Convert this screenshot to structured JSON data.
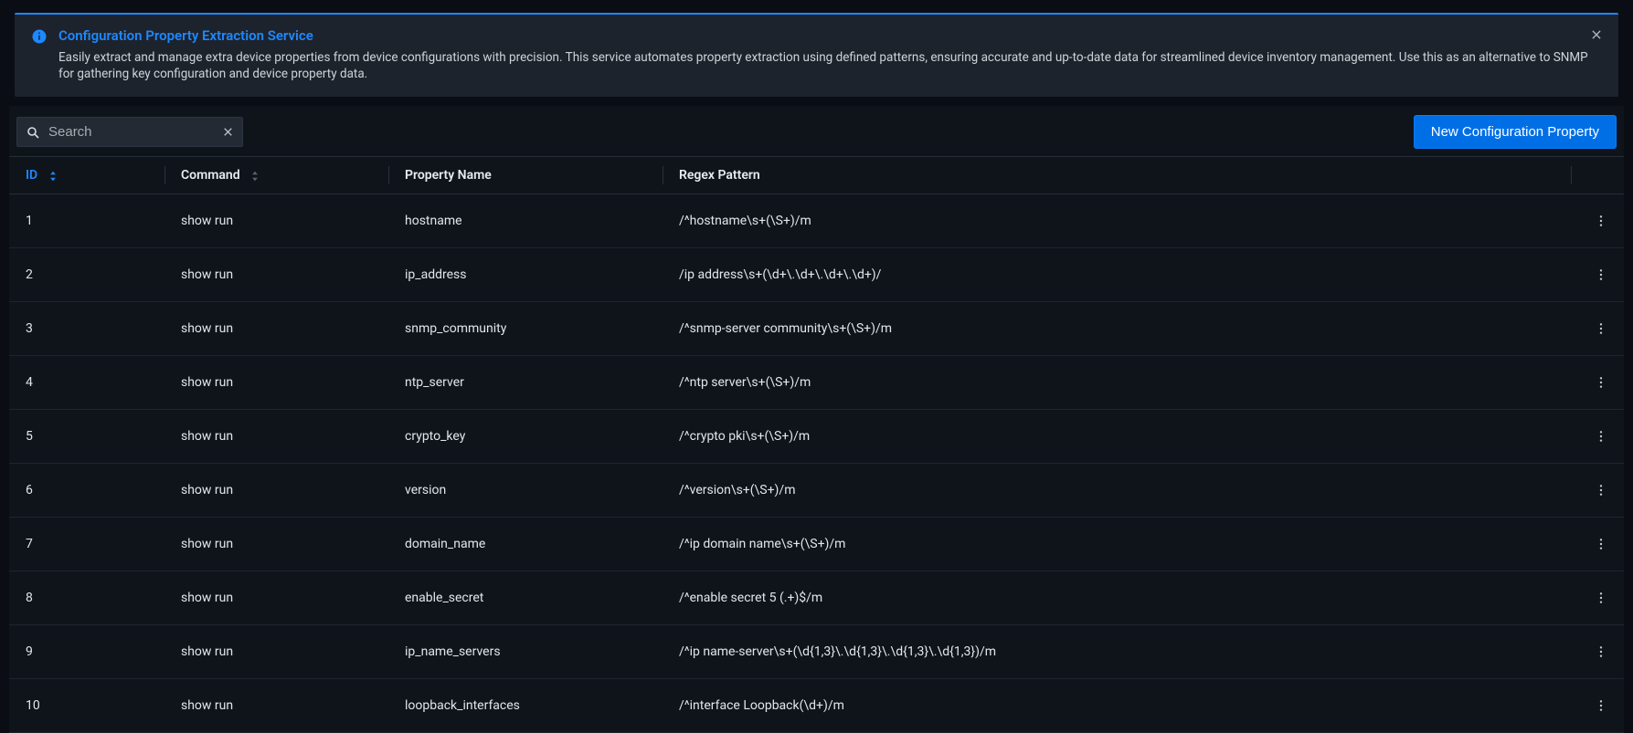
{
  "banner": {
    "title": "Configuration Property Extraction Service",
    "description": "Easily extract and manage extra device properties from device configurations with precision. This service automates property extraction using defined patterns, ensuring accurate and up-to-date data for streamlined device inventory management. Use this as an alternative to SNMP for gathering key configuration and device property data."
  },
  "toolbar": {
    "search_placeholder": "Search",
    "new_button_label": "New Configuration Property"
  },
  "table": {
    "columns": {
      "id": "ID",
      "command": "Command",
      "property_name": "Property Name",
      "regex_pattern": "Regex Pattern"
    },
    "rows": [
      {
        "id": "1",
        "command": "show run",
        "property": "hostname",
        "regex": "/^hostname\\s+(\\S+)/m"
      },
      {
        "id": "2",
        "command": "show run",
        "property": "ip_address",
        "regex": "/ip address\\s+(\\d+\\.\\d+\\.\\d+\\.\\d+)/"
      },
      {
        "id": "3",
        "command": "show run",
        "property": "snmp_community",
        "regex": "/^snmp-server community\\s+(\\S+)/m"
      },
      {
        "id": "4",
        "command": "show run",
        "property": "ntp_server",
        "regex": "/^ntp server\\s+(\\S+)/m"
      },
      {
        "id": "5",
        "command": "show run",
        "property": "crypto_key",
        "regex": "/^crypto pki\\s+(\\S+)/m"
      },
      {
        "id": "6",
        "command": "show run",
        "property": "version",
        "regex": "/^version\\s+(\\S+)/m"
      },
      {
        "id": "7",
        "command": "show run",
        "property": "domain_name",
        "regex": "/^ip domain name\\s+(\\S+)/m"
      },
      {
        "id": "8",
        "command": "show run",
        "property": "enable_secret",
        "regex": "/^enable secret 5 (.+)$/m"
      },
      {
        "id": "9",
        "command": "show run",
        "property": "ip_name_servers",
        "regex": "/^ip name-server\\s+(\\d{1,3}\\.\\d{1,3}\\.\\d{1,3}\\.\\d{1,3})/m"
      },
      {
        "id": "10",
        "command": "show run",
        "property": "loopback_interfaces",
        "regex": "/^interface Loopback(\\d+)/m"
      }
    ]
  }
}
